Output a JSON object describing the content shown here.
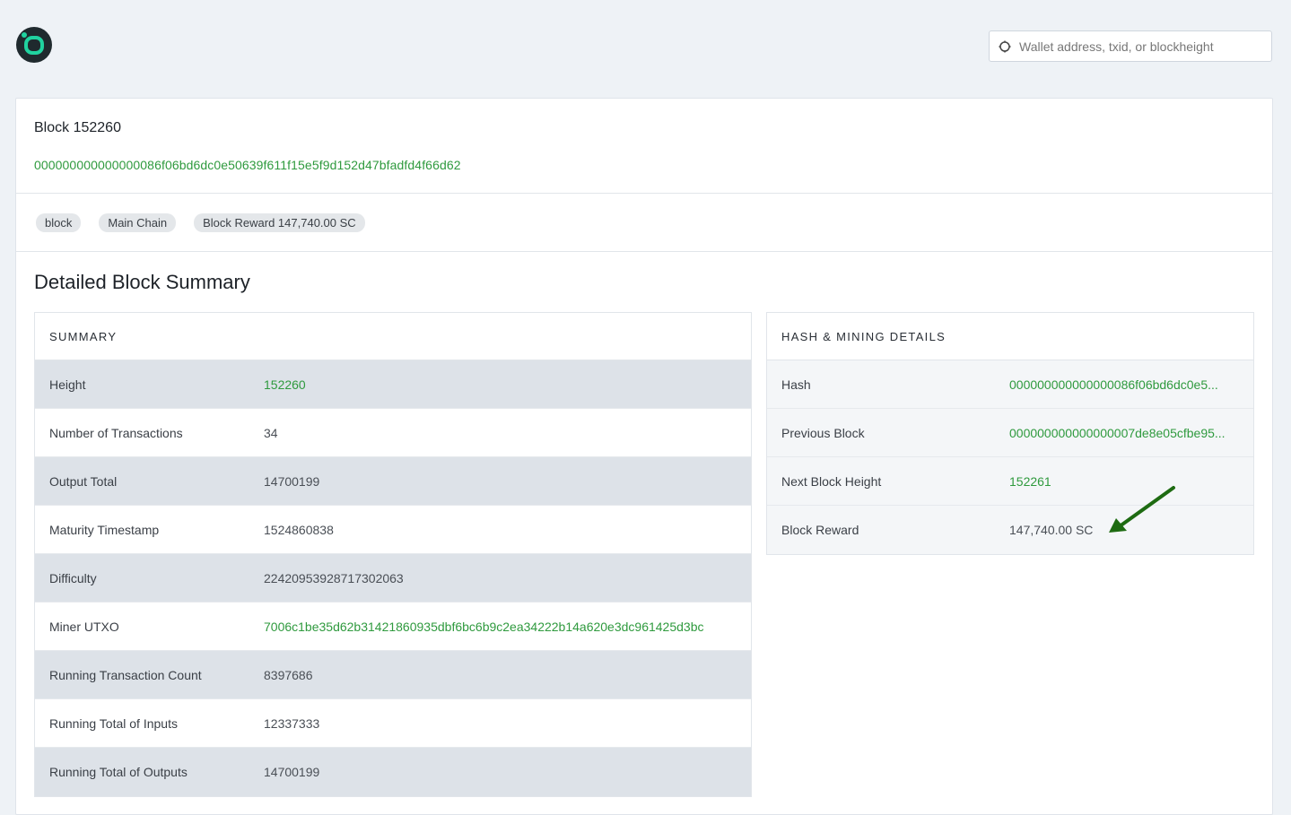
{
  "search": {
    "placeholder": "Wallet address, txid, or blockheight"
  },
  "block": {
    "title": "Block 152260",
    "hash": "000000000000000086f06bd6dc0e50639f611f15e5f9d152d47bfadfd4f66d62"
  },
  "tags": [
    "block",
    "Main Chain",
    "Block Reward 147,740.00 SC"
  ],
  "section_title": "Detailed Block Summary",
  "summary": {
    "header": "SUMMARY",
    "rows": [
      {
        "label": "Height",
        "value": "152260"
      },
      {
        "label": "Number of Transactions",
        "value": "34"
      },
      {
        "label": "Output Total",
        "value": "14700199"
      },
      {
        "label": "Maturity Timestamp",
        "value": "1524860838"
      },
      {
        "label": "Difficulty",
        "value": "22420953928717302063"
      },
      {
        "label": "Miner UTXO",
        "value": "7006c1be35d62b31421860935dbf6bc6b9c2ea34222b14a620e3dc961425d3bc"
      },
      {
        "label": "Running Transaction Count",
        "value": "8397686"
      },
      {
        "label": "Running Total of Inputs",
        "value": "12337333"
      },
      {
        "label": "Running Total of Outputs",
        "value": "14700199"
      }
    ]
  },
  "hash_details": {
    "header": "HASH & MINING DETAILS",
    "rows": [
      {
        "label": "Hash",
        "value": "000000000000000086f06bd6dc0e5..."
      },
      {
        "label": "Previous Block",
        "value": "000000000000000007de8e05cfbe95..."
      },
      {
        "label": "Next Block Height",
        "value": "152261"
      },
      {
        "label": "Block Reward",
        "value": "147,740.00 SC"
      }
    ]
  },
  "colors": {
    "accent": "#2f9a3e",
    "arrow": "#1e6b12",
    "logo_bg": "#1f2a2e",
    "logo_fg": "#20d3a0"
  },
  "icons": {
    "logo": "sia-logo-icon",
    "search": "search-icon",
    "annotation": "arrow-icon"
  }
}
